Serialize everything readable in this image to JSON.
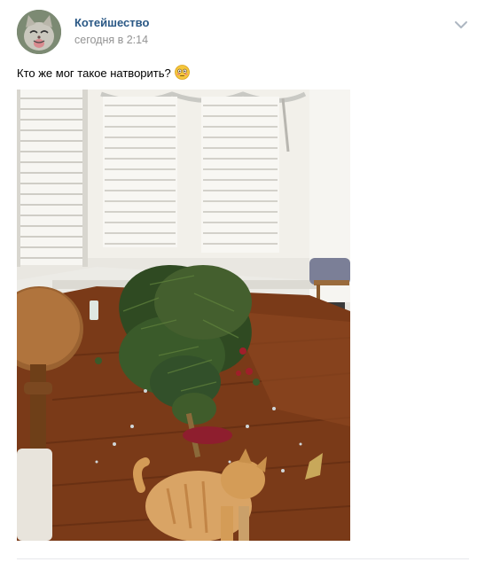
{
  "post": {
    "author": "Котейшество",
    "time": "сегодня в 2:14",
    "text": "Кто же мог такое натворить?"
  },
  "icons": {
    "avatar": "cat-avatar",
    "menu": "chevron-down-icon",
    "emoji": "flushed-face-emoji"
  },
  "colors": {
    "author_link": "#2a5885",
    "timestamp": "#939393",
    "divider": "#e7e8ec"
  }
}
